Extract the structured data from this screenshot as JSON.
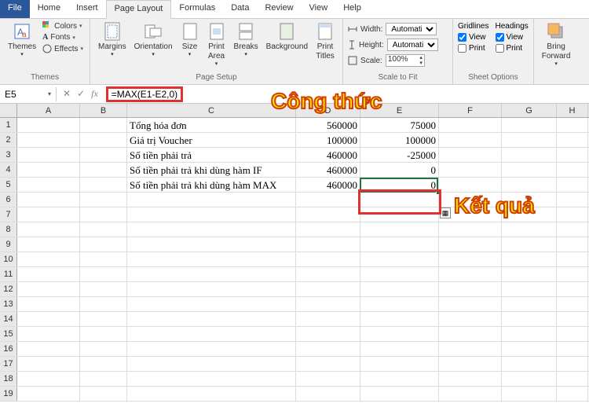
{
  "tabs": [
    "File",
    "Home",
    "Insert",
    "Page Layout",
    "Formulas",
    "Data",
    "Review",
    "View",
    "Help"
  ],
  "active_tab": "Page Layout",
  "ribbon": {
    "themes": {
      "title": "Themes",
      "themes_btn": "Themes",
      "colors": "Colors",
      "fonts": "Fonts",
      "effects": "Effects"
    },
    "page_setup": {
      "title": "Page Setup",
      "margins": "Margins",
      "orientation": "Orientation",
      "size": "Size",
      "print_area": "Print\nArea",
      "breaks": "Breaks",
      "background": "Background",
      "print_titles": "Print\nTitles"
    },
    "scale": {
      "title": "Scale to Fit",
      "width_label": "Width:",
      "width_val": "Automatic",
      "height_label": "Height:",
      "height_val": "Automatic",
      "scale_label": "Scale:",
      "scale_val": "100%"
    },
    "sheet": {
      "title": "Sheet Options",
      "gridlines": "Gridlines",
      "headings": "Headings",
      "view": "View",
      "print": "Print"
    },
    "arrange": {
      "title": "",
      "bring_fwd": "Bring\nForward"
    }
  },
  "formula_bar": {
    "cell_ref": "E5",
    "formula": "=MAX(E1-E2,0)"
  },
  "columns": [
    "A",
    "B",
    "C",
    "D",
    "E",
    "F",
    "G",
    "H"
  ],
  "rows": [
    {
      "n": 1,
      "C": "Tổng hóa đơn",
      "D": "560000",
      "E": "75000"
    },
    {
      "n": 2,
      "C": "Giá trị Voucher",
      "D": "100000",
      "E": "100000"
    },
    {
      "n": 3,
      "C": "Số tiền phải trả",
      "D": "460000",
      "E": "-25000"
    },
    {
      "n": 4,
      "C": "Số tiền phải trả khi dùng hàm IF",
      "D": "460000",
      "E": "0"
    },
    {
      "n": 5,
      "C": "Số tiền phải trả khi dùng hàm MAX",
      "D": "460000",
      "E": "0"
    },
    {
      "n": 6
    },
    {
      "n": 7
    },
    {
      "n": 8
    },
    {
      "n": 9
    },
    {
      "n": 10
    },
    {
      "n": 11
    },
    {
      "n": 12
    },
    {
      "n": 13
    },
    {
      "n": 14
    },
    {
      "n": 15
    },
    {
      "n": 16
    },
    {
      "n": 17
    },
    {
      "n": 18
    },
    {
      "n": 19
    }
  ],
  "annotations": {
    "formula_label": "Công thức",
    "result_label": "Kết quả"
  }
}
